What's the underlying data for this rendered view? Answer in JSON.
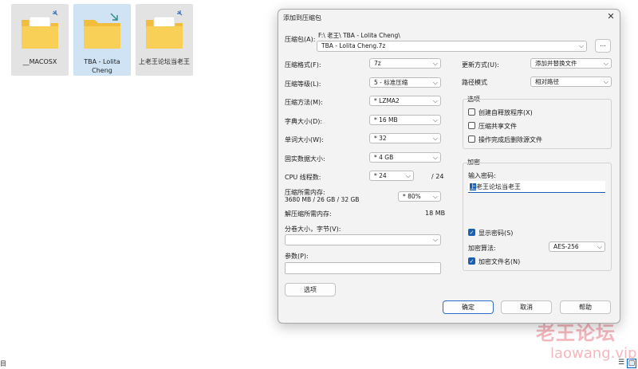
{
  "explorer": {
    "folders": [
      {
        "label": "__MACOSX"
      },
      {
        "label": "TBA - Lolita Cheng"
      },
      {
        "label": "上老王论坛当老王"
      }
    ],
    "status_left": "目"
  },
  "watermark": {
    "line1": "老王论坛",
    "line2": "laowang.vip"
  },
  "dialog": {
    "title": "添加到压缩包",
    "close_symbol": "✕",
    "archive": {
      "label": "压缩包(A):",
      "path": "F:\\ 老王\\ TBA - Lolita Cheng\\",
      "value": "TBA - Lolita Cheng.7z",
      "browse": "..."
    },
    "format": {
      "label": "压缩格式(F):",
      "value": "7z"
    },
    "level": {
      "label": "压缩等级(L):",
      "value": "5 - 标准压缩"
    },
    "method": {
      "label": "压缩方法(M):",
      "value": "*  LZMA2"
    },
    "dict": {
      "label": "字典大小(D):",
      "value": "*  16 MB"
    },
    "word": {
      "label": "单词大小(W):",
      "value": "*  32"
    },
    "solid": {
      "label": "固实数据大小:",
      "value": "*  4 GB"
    },
    "cpu": {
      "label": "CPU 线程数:",
      "value": "*  24",
      "total": "/  24"
    },
    "mem_compress": {
      "label": "压缩所需内存:",
      "detail": "3680 MB / 26 GB / 32 GB",
      "percent": "*  80%"
    },
    "mem_decompress": {
      "label": "解压缩所需内存:",
      "value": "18 MB"
    },
    "split": {
      "label": "分卷大小，字节(V):",
      "value": ""
    },
    "params": {
      "label": "参数(P):",
      "value": ""
    },
    "options_button": "选项",
    "update": {
      "label": "更新方式(U):",
      "value": "添加并替换文件"
    },
    "pathmode": {
      "label": "路径模式",
      "value": "相对路径"
    },
    "options_group": {
      "title": "选项",
      "items": [
        {
          "label": "创建自释放程序(X)",
          "checked": false
        },
        {
          "label": "压缩共享文件",
          "checked": false
        },
        {
          "label": "操作完成后删除源文件",
          "checked": false
        }
      ]
    },
    "encryption": {
      "title": "加密",
      "password_label": "输入密码:",
      "password_first": "上",
      "password_rest": "老王论坛当老王",
      "show_password": {
        "label": "显示密码(S)",
        "checked": true
      },
      "method_label": "加密算法:",
      "method_value": "AES-256",
      "encrypt_names": {
        "label": "加密文件名(N)",
        "checked": true
      }
    },
    "buttons": {
      "ok": "确定",
      "cancel": "取消",
      "help": "帮助"
    },
    "check_mark": "✓",
    "chevron": "⌵"
  },
  "colors": {
    "accent": "#1a5fb4",
    "folder": "#f6c94a",
    "watermark": "#f4b7bd"
  }
}
